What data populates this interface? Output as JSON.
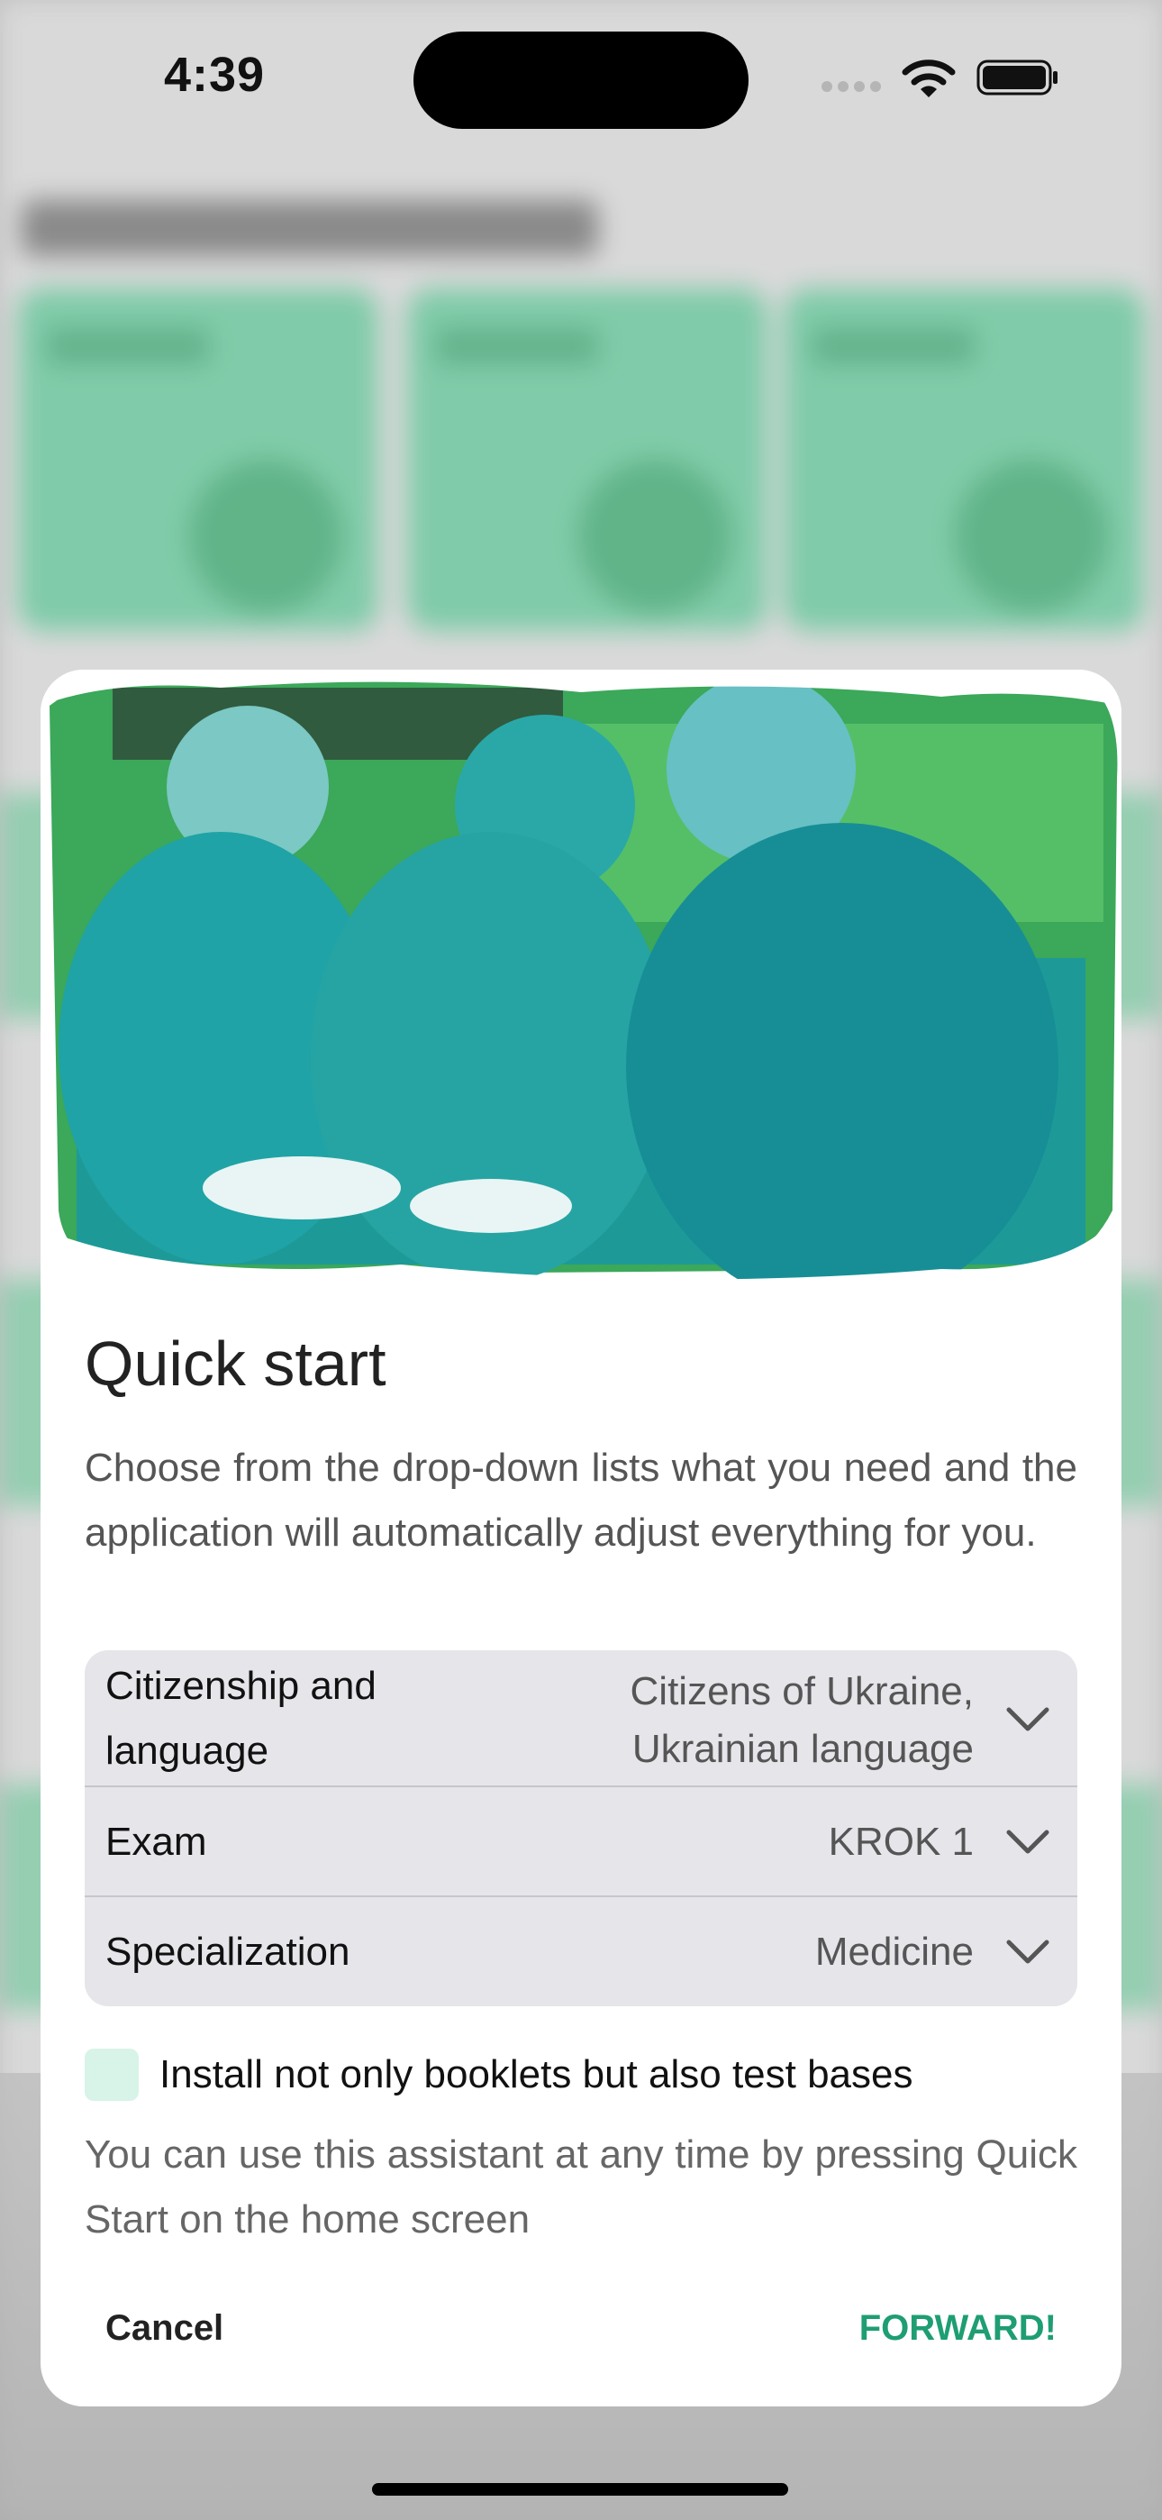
{
  "status_bar": {
    "time": "4:39"
  },
  "modal": {
    "title": "Quick start",
    "description": "Choose from the drop-down lists what you need and the application will automatically adjust everything for you.",
    "dropdowns": [
      {
        "label": "Citizenship and language",
        "value": "Citizens of Ukraine, Ukrainian language",
        "icon": "chevron-down-icon"
      },
      {
        "label": "Exam",
        "value": "KROK 1",
        "icon": "chevron-down-icon"
      },
      {
        "label": "Specialization",
        "value": "Medicine",
        "icon": "chevron-down-icon"
      }
    ],
    "checkbox": {
      "label": "Install not only booklets but also test bases",
      "checked": false
    },
    "hint": "You can use this assistant at any time by pressing Quick Start on the home screen",
    "cancel_label": "Cancel",
    "forward_label": "FORWARD!"
  },
  "colors": {
    "accent": "#1e9e72",
    "background_cards": "#8fe3bd"
  }
}
